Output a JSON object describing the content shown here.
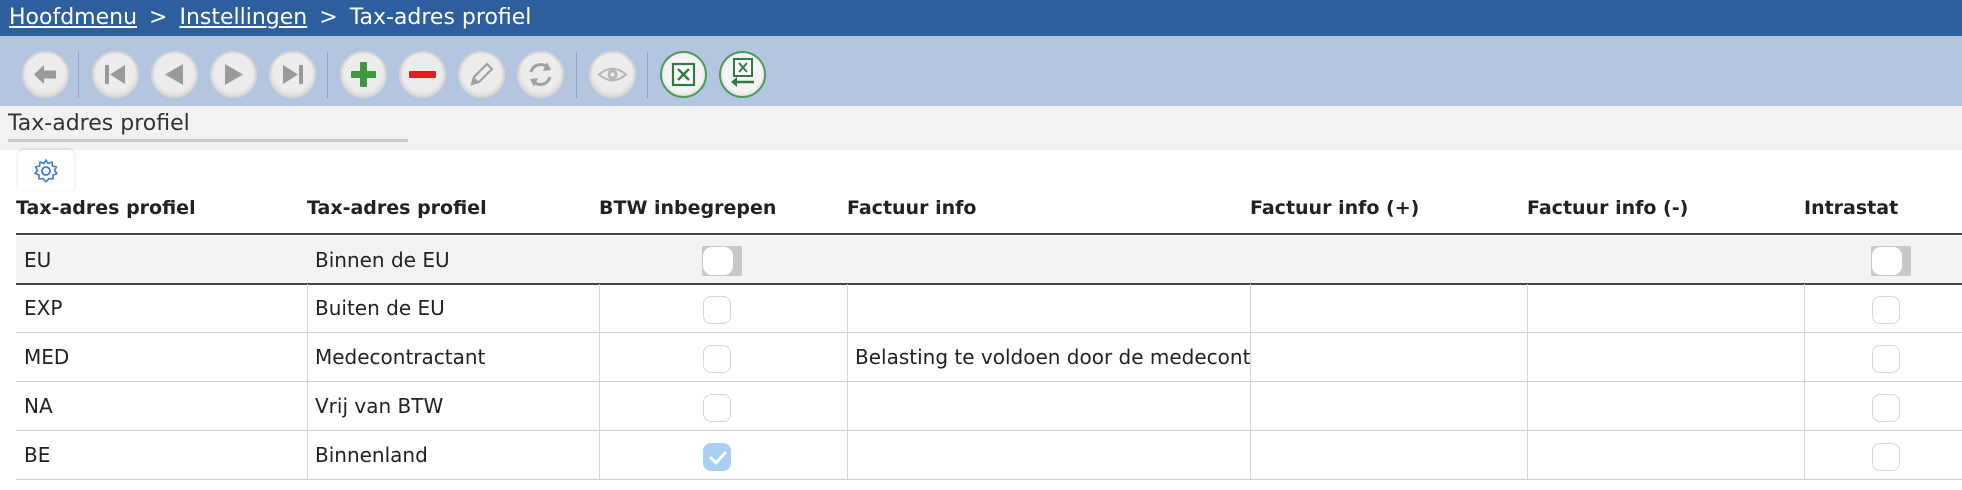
{
  "breadcrumb": {
    "home": "Hoofdmenu",
    "sep1": ">",
    "settings": "Instellingen",
    "sep2": ">",
    "current": "Tax-adres profiel"
  },
  "toolbar": {
    "buttons": [
      "back-icon",
      "first-icon",
      "previous-icon",
      "next-icon",
      "last-icon",
      "add-icon",
      "delete-icon",
      "edit-icon",
      "refresh-icon",
      "view-icon",
      "export-excel-icon",
      "import-excel-icon"
    ]
  },
  "subheader": {
    "title": "Tax-adres profiel"
  },
  "table": {
    "columns": [
      "Tax-adres profiel",
      "Tax-adres profiel",
      "BTW inbegrepen",
      "Factuur info",
      "Factuur info (+)",
      "Factuur info (-)",
      "Intrastat"
    ],
    "rows": [
      {
        "code": "EU",
        "name": "Binnen de EU",
        "btw": false,
        "info": "",
        "info_plus": "",
        "info_min": "",
        "intrastat": false
      },
      {
        "code": "EXP",
        "name": "Buiten de EU",
        "btw": false,
        "info": "",
        "info_plus": "",
        "info_min": "",
        "intrastat": false
      },
      {
        "code": "MED",
        "name": "Medecontractant",
        "btw": false,
        "info": "Belasting te voldoen door de medecontr",
        "info_plus": "",
        "info_min": "",
        "intrastat": false
      },
      {
        "code": "NA",
        "name": "Vrij van BTW",
        "btw": false,
        "info": "",
        "info_plus": "",
        "info_min": "",
        "intrastat": false
      },
      {
        "code": "BE",
        "name": "Binnenland",
        "btw": true,
        "info": "",
        "info_plus": "",
        "info_min": "",
        "intrastat": false
      }
    ]
  },
  "colors": {
    "breadcrumb_bg": "#2d5f9e",
    "toolbar_bg": "#b3c5df",
    "check_blue": "#a9cff4",
    "add_green": "#3a9a3a",
    "delete_red": "#e02020"
  }
}
